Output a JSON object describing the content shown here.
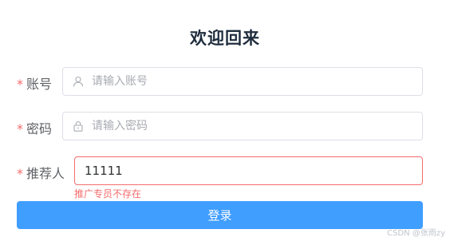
{
  "title": "欢迎回来",
  "form": {
    "required_mark": "*",
    "account": {
      "label": "账号",
      "placeholder": "请输入账号",
      "value": "",
      "icon": "user-icon"
    },
    "password": {
      "label": "密码",
      "placeholder": "请输入密码",
      "value": "",
      "icon": "lock-icon"
    },
    "referrer": {
      "label": "推荐人",
      "value": "11111",
      "error": "推广专员不存在"
    },
    "submit_label": "登录"
  },
  "watermark": "CSDN @张雨zy",
  "colors": {
    "primary": "#409eff",
    "danger": "#f56c6c",
    "border": "#dcdfe6"
  }
}
